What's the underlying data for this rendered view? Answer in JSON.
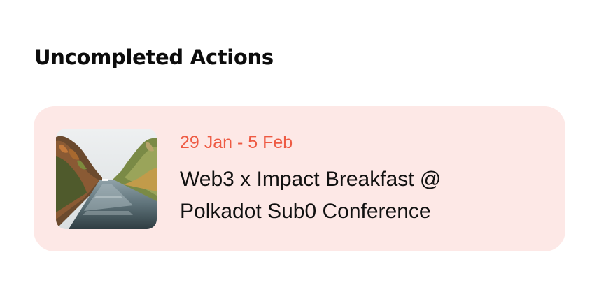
{
  "section": {
    "title": "Uncompleted Actions"
  },
  "actions": [
    {
      "date_range": "29 Jan - 5 Feb",
      "title": "Web3 x Impact Breakfast @ Polkadot Sub0 Conference",
      "thumbnail_icon": "river-canal-photo"
    }
  ],
  "colors": {
    "card_background": "#fde8e6",
    "date_accent": "#ee5a43",
    "title_text": "#111111"
  }
}
